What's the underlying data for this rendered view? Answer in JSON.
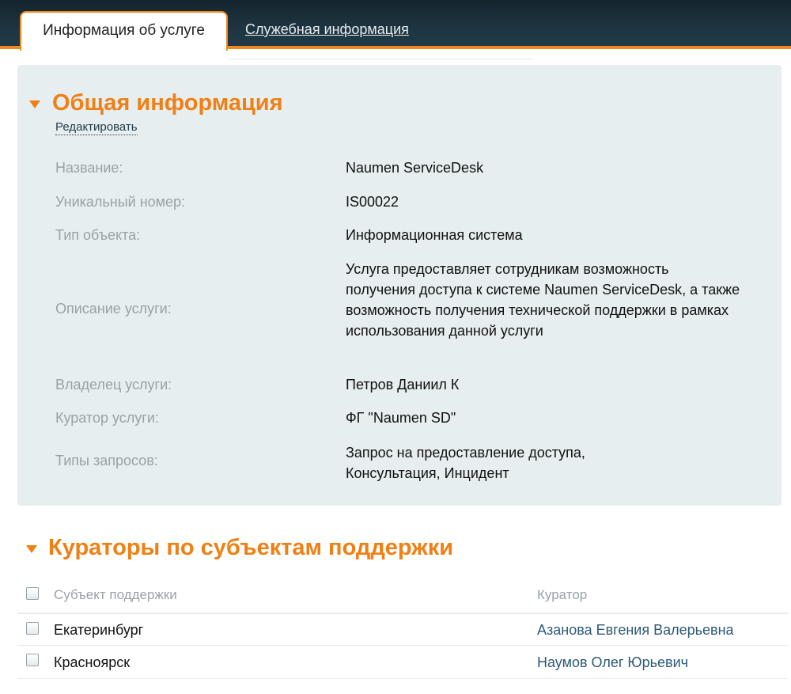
{
  "tabs": {
    "active": "Информация об услуге",
    "inactive": "Служебная информация"
  },
  "general": {
    "title": "Общая информация",
    "edit_label": "Редактировать",
    "fields": {
      "name": {
        "label": "Название:",
        "value": "Naumen ServiceDesk"
      },
      "number": {
        "label": "Уникальный номер:",
        "value": "IS00022"
      },
      "type": {
        "label": "Тип объекта:",
        "value": "Информационная система"
      },
      "description": {
        "label": "Описание услуги:",
        "value": "Услуга предоставляет сотрудникам возможность получения доступа к системе Naumen ServiceDesk, а также возможность получения технической поддержки в рамках использования данной услуги"
      },
      "owner": {
        "label": "Владелец услуги:",
        "value": "Петров Даниил К"
      },
      "curator": {
        "label": "Куратор услуги:",
        "value": "ФГ \"Naumen SD\""
      },
      "request_types": {
        "label": "Типы запросов:",
        "value": "Запрос на предоставление доступа, Консультация, Инцидент"
      }
    }
  },
  "curators": {
    "title": "Кураторы по субъектам поддержки",
    "columns": {
      "subject": "Субъект поддержки",
      "curator": "Куратор"
    },
    "rows": [
      {
        "subject": "Екатеринбург",
        "curator": "Азанова Евгения Валерьевна"
      },
      {
        "subject": "Красноярск",
        "curator": "Наумов Олег Юрьевич"
      }
    ]
  },
  "colors": {
    "accent": "#f07f14",
    "header_bg": "#1d3440",
    "panel_bg": "#e6eeef",
    "link": "#2c5a76"
  },
  "icons": {
    "section_toggle": "triangle-down-icon",
    "checkbox": "checkbox-icon"
  }
}
